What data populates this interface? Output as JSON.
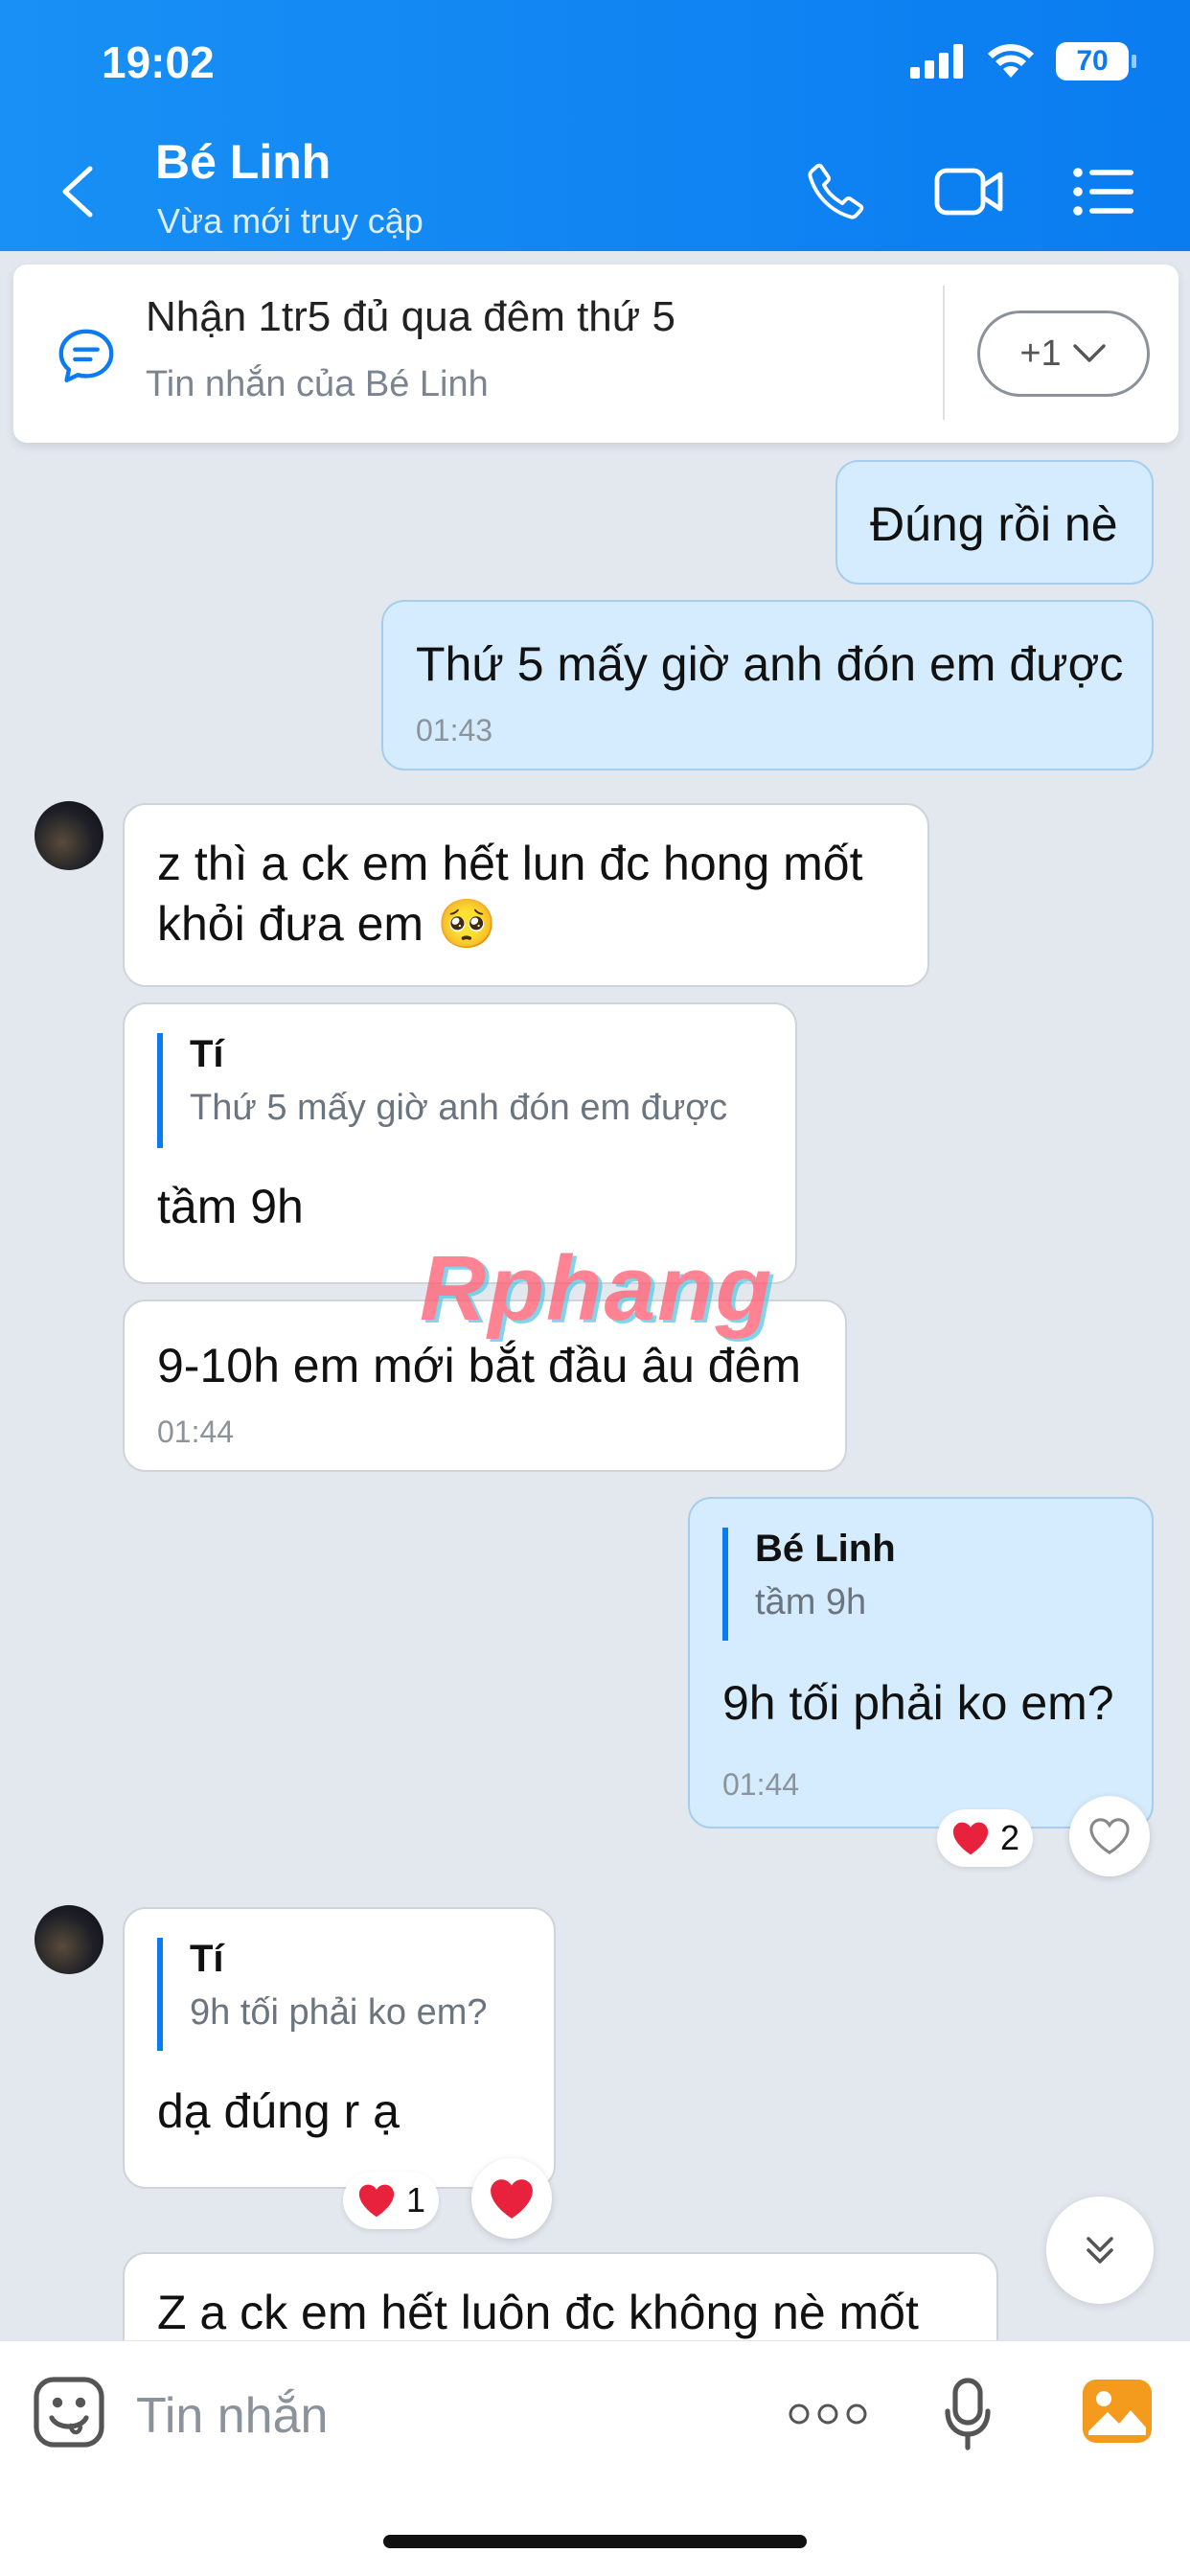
{
  "status_bar": {
    "time": "19:02",
    "battery": "70"
  },
  "header": {
    "contact_name": "Bé Linh",
    "contact_status": "Vừa mới truy cập",
    "icons": {
      "back": "back-chevron-icon",
      "call": "phone-icon",
      "video": "video-call-icon",
      "menu": "list-menu-icon"
    }
  },
  "pinned": {
    "title": "Nhận 1tr5 đủ qua đêm thứ 5",
    "subtitle": "Tin nhắn của Bé Linh",
    "more_count": "+1"
  },
  "messages": [
    {
      "from": "me",
      "text": "Đúng rồi nè"
    },
    {
      "from": "me",
      "text": "Thứ 5 mấy giờ anh đón em được",
      "time": "01:43"
    },
    {
      "from": "them",
      "text": "z thì a ck em hết lun đc hong mốt khỏi đưa em 🥺"
    },
    {
      "from": "them",
      "quote_name": "Tí",
      "quote_text": "Thứ 5 mấy giờ anh đón em được",
      "text": "tầm 9h"
    },
    {
      "from": "them",
      "text": "9-10h em mới bắt đầu âu đêm",
      "time": "01:44"
    },
    {
      "from": "me",
      "quote_name": "Bé Linh",
      "quote_text": "tầm 9h",
      "text": "9h tối phải ko em?",
      "time": "01:44",
      "reaction_count": "2"
    },
    {
      "from": "them",
      "quote_name": "Tí",
      "quote_text": "9h tối phải ko em?",
      "text": "dạ đúng r ạ",
      "reaction_count": "1"
    },
    {
      "from": "them",
      "text": "Z a ck em hết luôn đc không nè mốt"
    }
  ],
  "watermark": "Rphang",
  "input": {
    "placeholder": "Tin nhắn"
  },
  "colors": {
    "header": "#0a7cf0",
    "bubble_me": "#d4ecfd",
    "bubble_them": "#ffffff",
    "background": "#e3e8ef",
    "heart": "#e8213c"
  }
}
